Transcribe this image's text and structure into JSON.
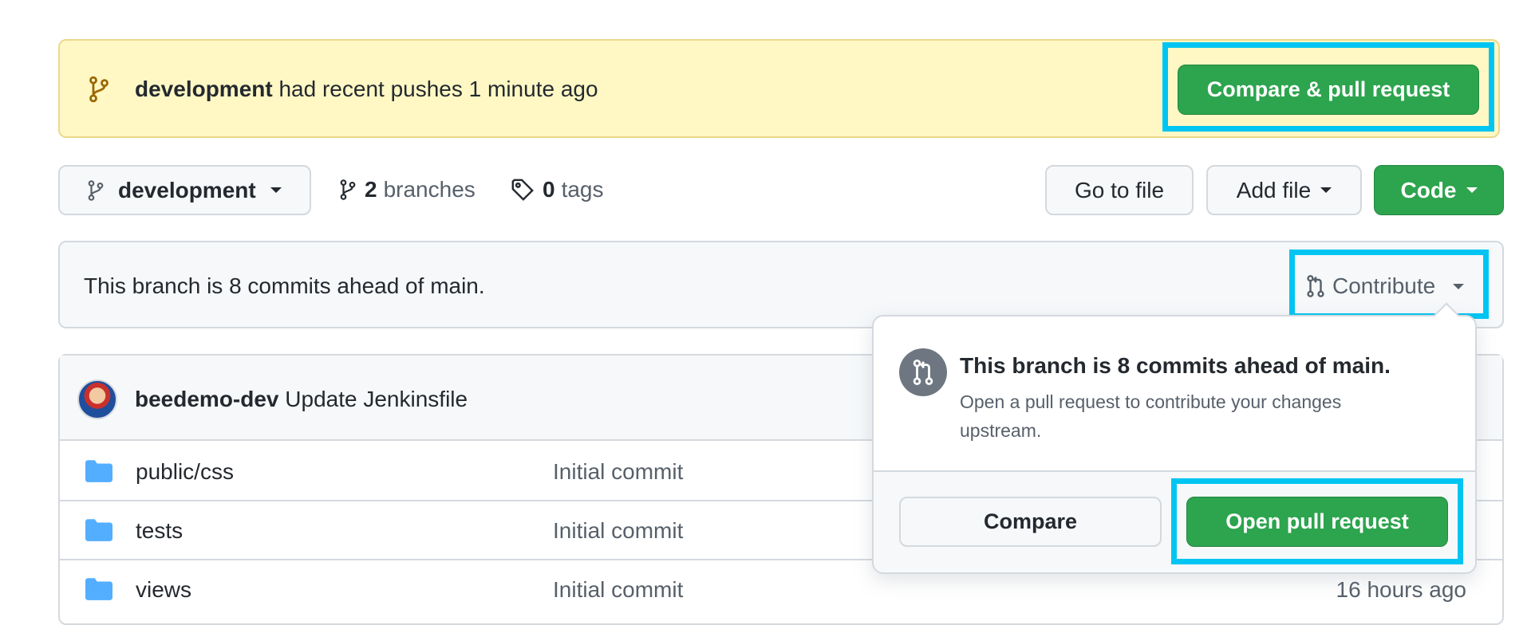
{
  "banner": {
    "branch": "development",
    "message": "had recent pushes 1 minute ago",
    "button_label": "Compare & pull request"
  },
  "toolbar": {
    "branch_label": "development",
    "branches_count": "2",
    "branches_label": "branches",
    "tags_count": "0",
    "tags_label": "tags",
    "goto_label": "Go to file",
    "addfile_label": "Add file",
    "code_label": "Code"
  },
  "ahead": {
    "text": "This branch is 8 commits ahead of main.",
    "contribute_label": "Contribute"
  },
  "commit": {
    "author": "beedemo-dev",
    "message": "Update Jenkinsfile"
  },
  "files": [
    {
      "name": "public/css",
      "message": "Initial commit",
      "time": ""
    },
    {
      "name": "tests",
      "message": "Initial commit",
      "time": ""
    },
    {
      "name": "views",
      "message": "Initial commit",
      "time": "16 hours ago"
    }
  ],
  "popover": {
    "title": "This branch is 8 commits ahead of main.",
    "description": "Open a pull request to contribute your changes upstream.",
    "compare_label": "Compare",
    "open_pr_label": "Open pull request"
  },
  "colors": {
    "accent_green": "#2da44e",
    "highlight": "#00c5f2",
    "banner_bg": "#fff8c5",
    "folder": "#54aeff"
  },
  "icons": {
    "banner": "git-branch-icon",
    "branches": "git-branch-icon",
    "tags": "tag-icon",
    "contribute": "git-pull-request-icon",
    "folder": "folder-icon"
  }
}
